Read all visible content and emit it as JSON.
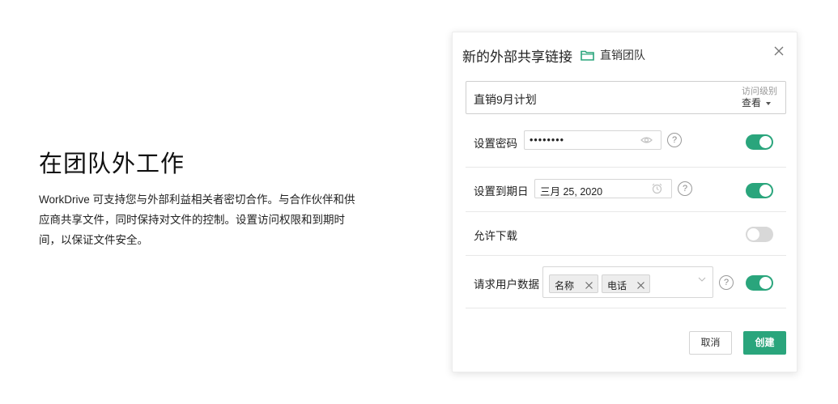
{
  "intro": {
    "heading": "在团队外工作",
    "line1": "WorkDrive 可支持您与外部利益相关者密切合作。与合作伙伴和供",
    "line2": "应商共享文件，同时保持对文件的控制。设置访问权限和到期时",
    "line3": "间，以保证文件安全。"
  },
  "dialog": {
    "title": "新的外部共享链接",
    "folder_name": "直销团队",
    "link_name": "直销9月计划",
    "access_label": "访问级别",
    "access_value": "查看",
    "password": {
      "label": "设置密码",
      "value": "••••••••",
      "enabled": true
    },
    "expiry": {
      "label": "设置到期日",
      "value": "三月 25, 2020",
      "enabled": true
    },
    "download": {
      "label": "允许下载",
      "enabled": false
    },
    "user_data": {
      "label": "请求用户数据",
      "tags": [
        "名称",
        "电话"
      ],
      "enabled": true
    },
    "help_glyph": "?",
    "cancel_label": "取消",
    "create_label": "创建"
  },
  "colors": {
    "accent": "#2aa57c",
    "toggle_off": "#d8d8d8",
    "folder": "#2aa57c"
  },
  "icons": [
    "folder-icon",
    "close-icon",
    "eye-icon",
    "alarm-clock-icon",
    "chevron-down-icon",
    "help-icon",
    "tag-remove-icon"
  ]
}
